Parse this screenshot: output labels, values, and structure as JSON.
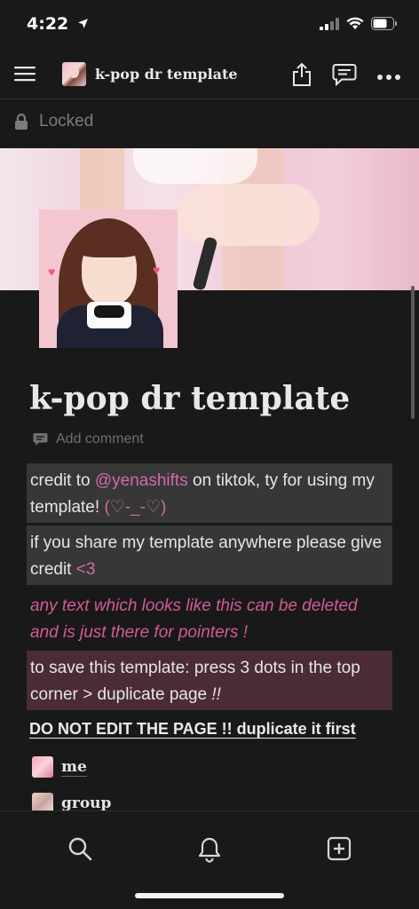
{
  "status_bar": {
    "time": "4:22"
  },
  "header": {
    "title": "k-pop dr template"
  },
  "locked": {
    "label": "Locked"
  },
  "page": {
    "title": "k-pop dr template",
    "add_comment": "Add comment"
  },
  "blocks": {
    "b1_pre": "credit to ",
    "b1_handle": "@yenashifts",
    "b1_mid": " on tiktok, ty for using my template! ",
    "b1_emote": "(♡-_-♡)",
    "b2_pre": "if you share my template anywhere please give credit ",
    "b2_heart": "<3",
    "b3": "any text which looks like this can be deleted and is just there for pointers !",
    "b4_text": "to save this template: press 3 dots in the top corner > duplicate page ",
    "b4_em": "!!",
    "b5": "DO NOT EDIT THE PAGE !! duplicate it first"
  },
  "sub_pages": [
    {
      "label": "me"
    },
    {
      "label": "group"
    }
  ],
  "colors": {
    "background": "#191919",
    "block_gray": "#373737",
    "block_pink": "#4a2b37",
    "accent_pink": "#d26aa6"
  },
  "icons": [
    "location-arrow-icon",
    "signal-icon",
    "wifi-icon",
    "battery-icon",
    "menu-icon",
    "share-icon",
    "comment-icon",
    "more-icon",
    "lock-icon",
    "search-icon",
    "bell-icon",
    "new-page-icon"
  ]
}
